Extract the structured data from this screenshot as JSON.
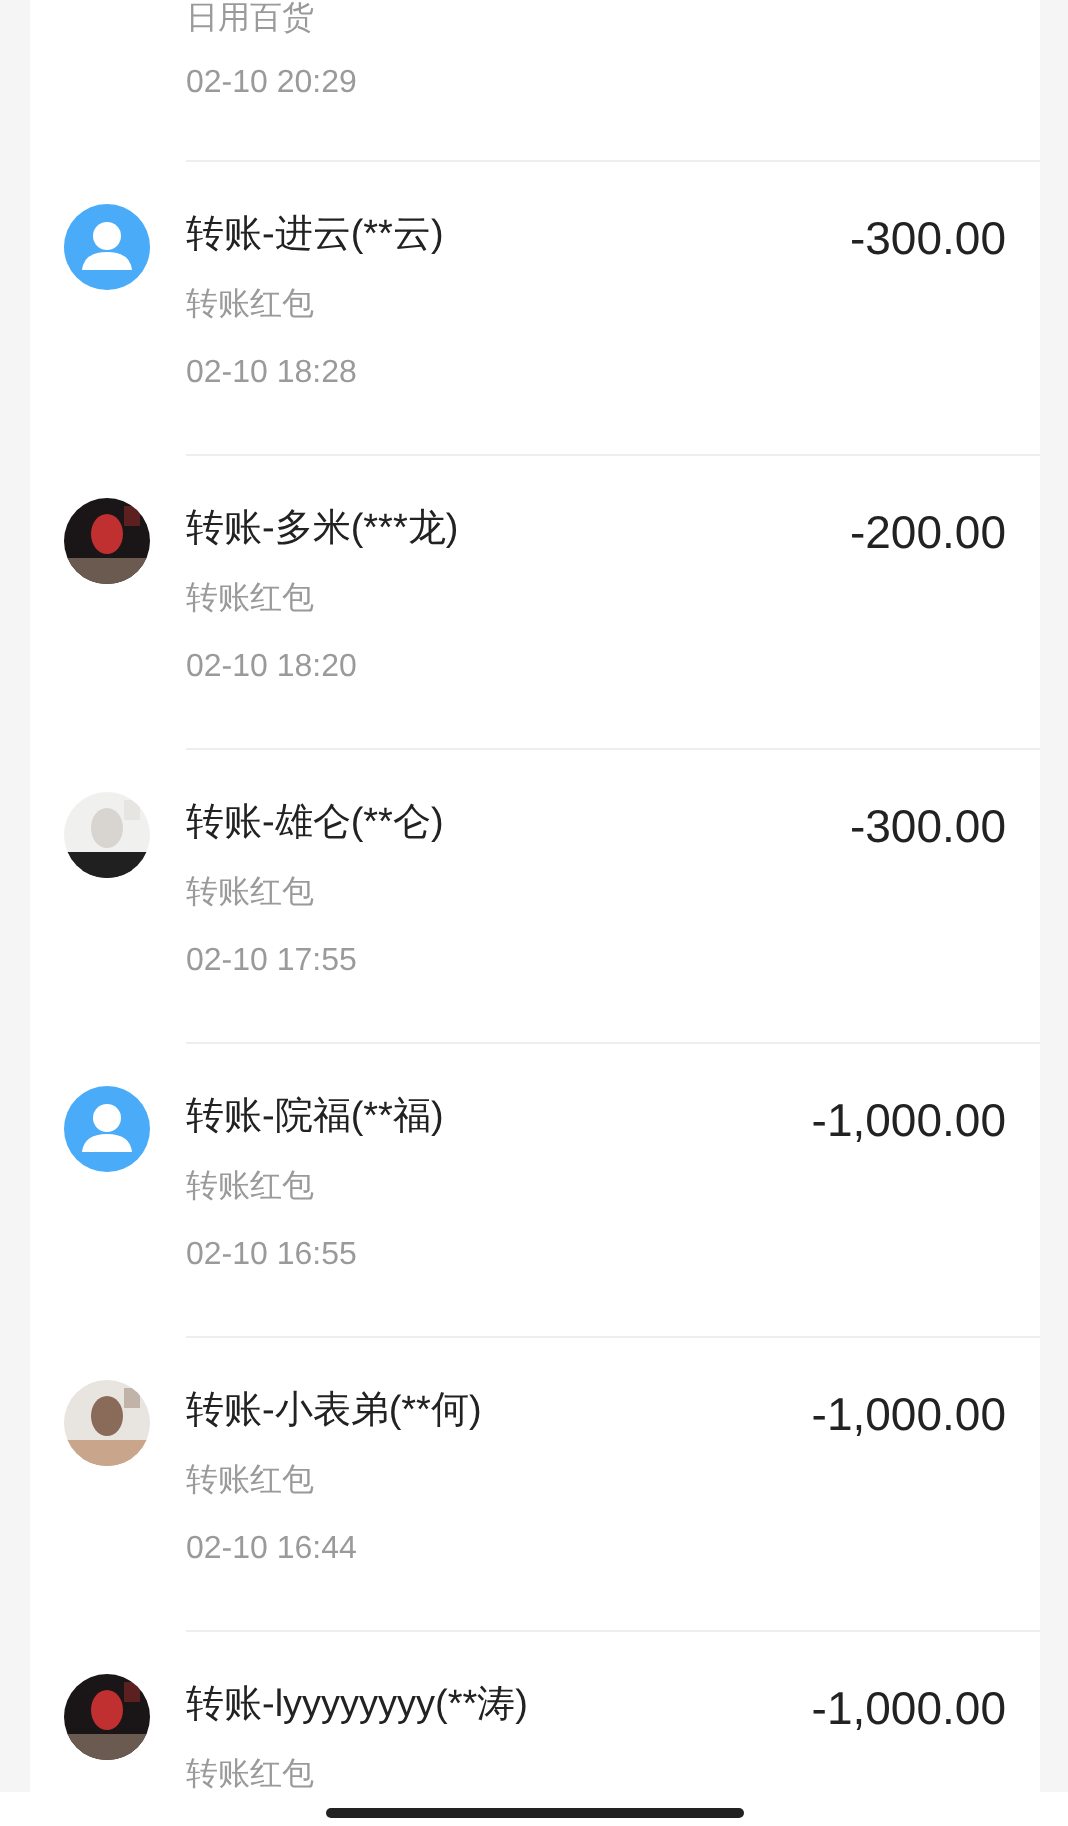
{
  "records": [
    {
      "category": "日用百货",
      "time": "02-10 20:29"
    },
    {
      "kind": "default",
      "title": "转账-进云(**云)",
      "category": "转账红包",
      "time": "02-10 18:28",
      "amount": "-300.00"
    },
    {
      "title": "转账-多米(***龙)",
      "category": "转账红包",
      "time": "02-10 18:20",
      "amount": "-200.00"
    },
    {
      "title": "转账-雄仑(**仑)",
      "category": "转账红包",
      "time": "02-10 17:55",
      "amount": "-300.00"
    },
    {
      "kind": "default",
      "title": "转账-院福(**福)",
      "category": "转账红包",
      "time": "02-10 16:55",
      "amount": "-1,000.00"
    },
    {
      "title": "转账-小表弟(**何)",
      "category": "转账红包",
      "time": "02-10 16:44",
      "amount": "-1,000.00"
    },
    {
      "title": "转账-lyyyyyyyy(**涛)",
      "category": "转账红包",
      "amount": "-1,000.00"
    }
  ]
}
